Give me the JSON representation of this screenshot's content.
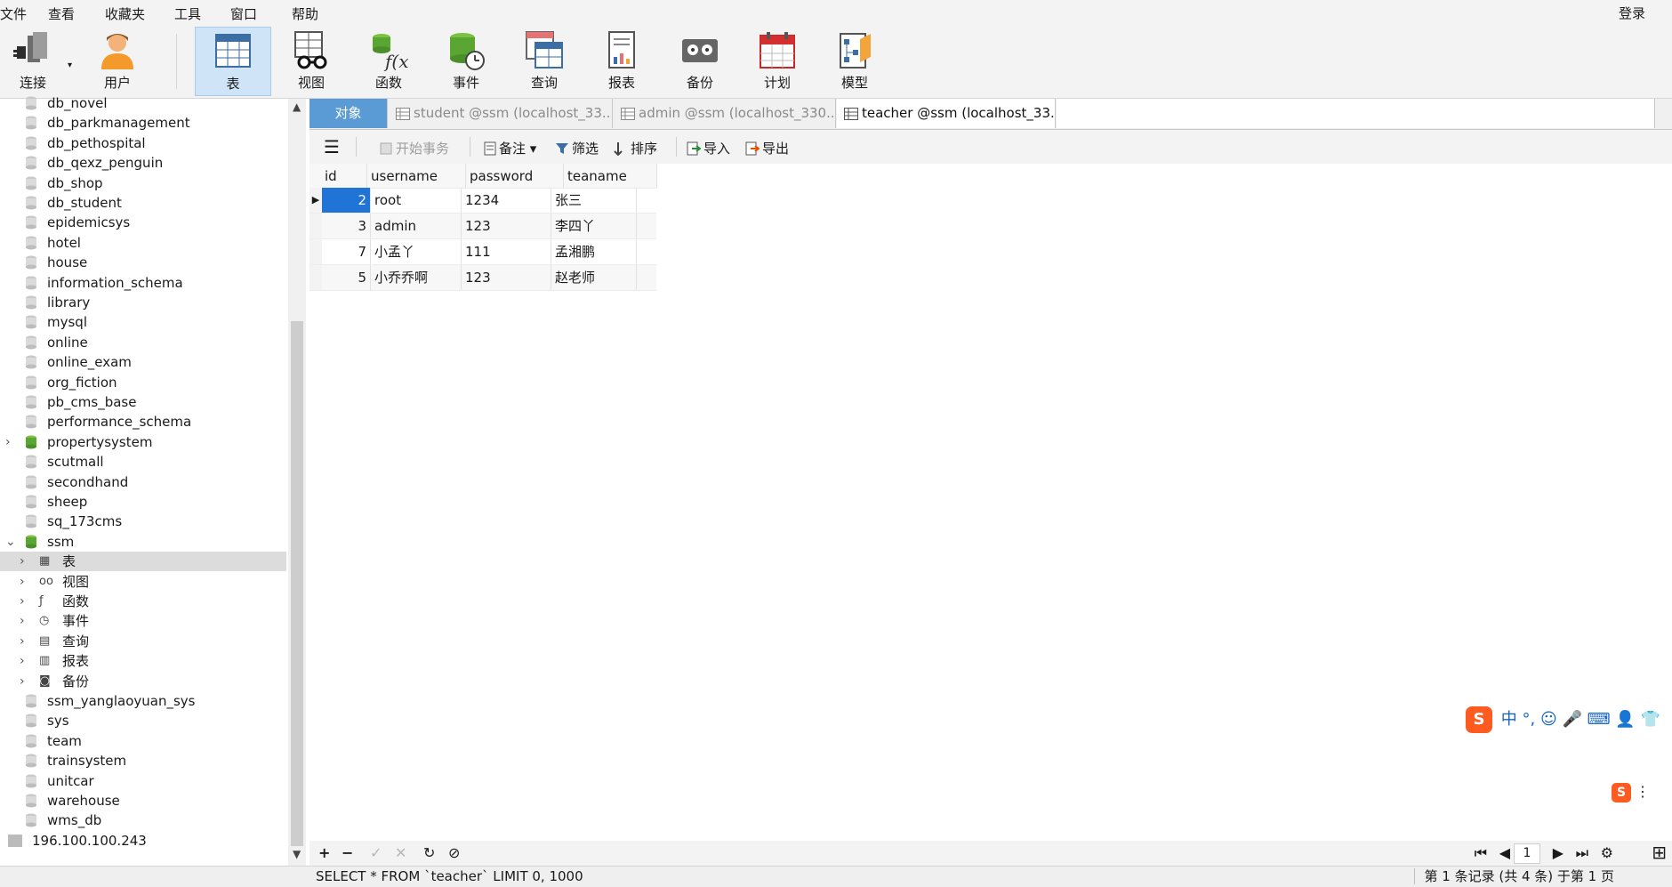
{
  "menu": [
    "文件",
    "查看",
    "收藏夹",
    "工具",
    "窗口",
    "帮助"
  ],
  "login_label": "登录",
  "toolbar": [
    {
      "label": "连接",
      "icon": "connection-icon"
    },
    {
      "label": "用户",
      "icon": "user-icon"
    },
    {
      "label": "表",
      "icon": "table-icon",
      "active": true
    },
    {
      "label": "视图",
      "icon": "view-icon"
    },
    {
      "label": "函数",
      "icon": "function-icon"
    },
    {
      "label": "事件",
      "icon": "event-icon"
    },
    {
      "label": "查询",
      "icon": "query-icon"
    },
    {
      "label": "报表",
      "icon": "report-icon"
    },
    {
      "label": "备份",
      "icon": "backup-icon"
    },
    {
      "label": "计划",
      "icon": "schedule-icon"
    },
    {
      "label": "模型",
      "icon": "model-icon"
    }
  ],
  "sidebar": {
    "databases_top": [
      "db_novel",
      "db_parkmanagement",
      "db_pethospital",
      "db_qexz_penguin",
      "db_shop",
      "db_student",
      "epidemicsys",
      "hotel",
      "house",
      "information_schema",
      "library",
      "mysql",
      "online",
      "online_exam",
      "org_fiction",
      "pb_cms_base",
      "performance_schema"
    ],
    "propertysystem": "propertysystem",
    "databases_mid": [
      "scutmall",
      "secondhand",
      "sheep",
      "sq_173cms"
    ],
    "ssm": "ssm",
    "ssm_children": [
      {
        "label": "表",
        "icon": "table-icon"
      },
      {
        "label": "视图",
        "icon": "view-icon"
      },
      {
        "label": "函数",
        "icon": "function-icon"
      },
      {
        "label": "事件",
        "icon": "event-icon"
      },
      {
        "label": "查询",
        "icon": "query-icon"
      },
      {
        "label": "报表",
        "icon": "report-icon"
      },
      {
        "label": "备份",
        "icon": "backup-icon"
      }
    ],
    "databases_bottom": [
      "ssm_yanglaoyuan_sys",
      "sys",
      "team",
      "trainsystem",
      "unitcar",
      "warehouse",
      "wms_db"
    ],
    "host": "196.100.100.243"
  },
  "tabs": {
    "objects": "对象",
    "items": [
      "student @ssm (localhost_33...",
      "admin @ssm (localhost_330...",
      "teacher @ssm (localhost_33..."
    ]
  },
  "subtoolbar": {
    "begin_tx": "开始事务",
    "note": "备注",
    "filter": "筛选",
    "sort": "排序",
    "import": "导入",
    "export": "导出"
  },
  "grid": {
    "columns": [
      "id",
      "username",
      "password",
      "teaname"
    ],
    "rows": [
      [
        "2",
        "root",
        "1234",
        "张三"
      ],
      [
        "3",
        "admin",
        "123",
        "李四丫"
      ],
      [
        "7",
        "小孟丫",
        "111",
        "孟湘鹏"
      ],
      [
        "5",
        "小乔乔啊",
        "123",
        "赵老师"
      ]
    ]
  },
  "ime": {
    "lang": "中"
  },
  "pager": {
    "page": "1"
  },
  "status": {
    "sql": "SELECT * FROM `teacher` LIMIT 0, 1000",
    "info": "第 1 条记录 (共 4 条) 于第 1 页"
  },
  "colors": {
    "accent": "#1f74d6",
    "tab_active": "#5b9bd5",
    "db_green": "#4caf50"
  }
}
